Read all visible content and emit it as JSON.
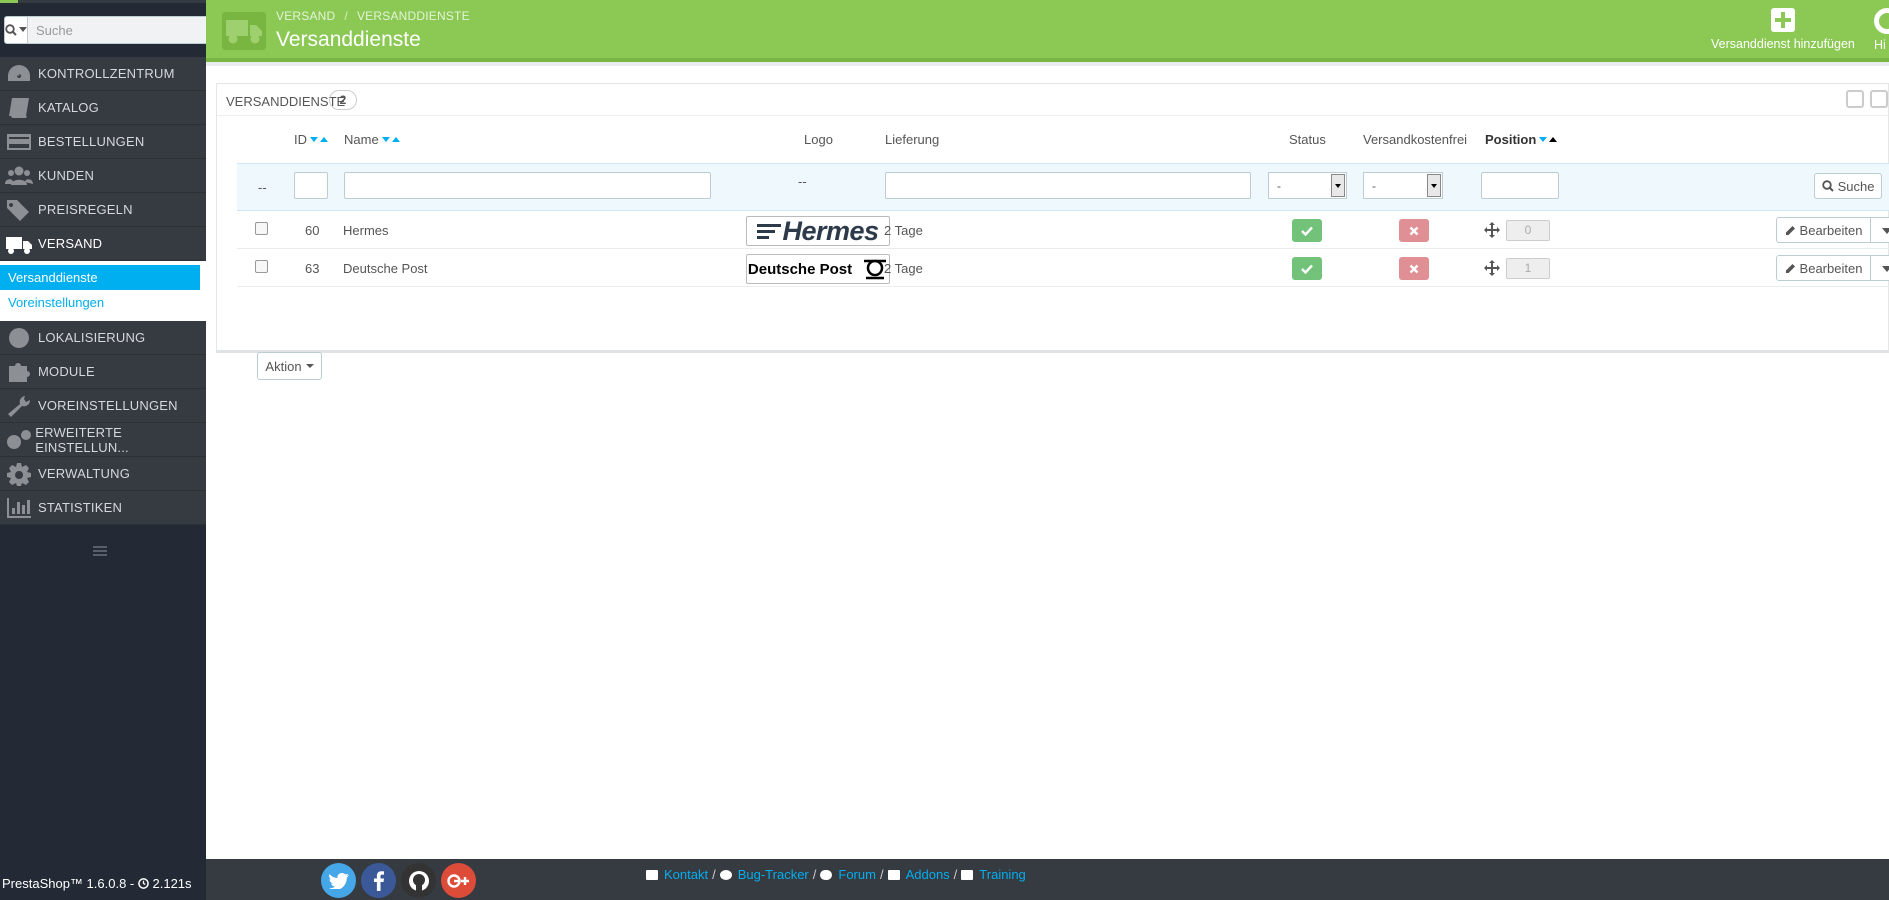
{
  "sidebar": {
    "search_placeholder": "Suche",
    "menu": [
      {
        "label": "KONTROLLZENTRUM",
        "icon": "dashboard-icon"
      },
      {
        "label": "KATALOG",
        "icon": "book-icon"
      },
      {
        "label": "BESTELLUNGEN",
        "icon": "credit-card-icon"
      },
      {
        "label": "KUNDEN",
        "icon": "users-icon"
      },
      {
        "label": "PREISREGELN",
        "icon": "tags-icon"
      },
      {
        "label": "VERSAND",
        "icon": "truck-icon"
      },
      {
        "label": "LOKALISIERUNG",
        "icon": "globe-icon"
      },
      {
        "label": "MODULE",
        "icon": "puzzle-icon"
      },
      {
        "label": "VOREINSTELLUNGEN",
        "icon": "wrench-icon"
      },
      {
        "label": "ERWEITERTE EINSTELLUN...",
        "icon": "cogs-icon"
      },
      {
        "label": "VERWALTUNG",
        "icon": "gear-icon"
      },
      {
        "label": "STATISTIKEN",
        "icon": "bar-chart-icon"
      }
    ],
    "submenu": [
      {
        "label": "Versanddienste"
      },
      {
        "label": "Voreinstellungen"
      }
    ],
    "version": "PrestaShop™ 1.6.0.8 -",
    "load_time": "2.121s"
  },
  "header": {
    "breadcrumb": [
      "VERSAND",
      "VERSANDDIENSTE"
    ],
    "title": "Versanddienste",
    "add_label": "Versanddienst hinzufügen",
    "help_label": "Hi"
  },
  "panel": {
    "title": "VERSANDDIENSTE",
    "count": "2",
    "columns": {
      "id": "ID",
      "name": "Name",
      "logo": "Logo",
      "delivery": "Lieferung",
      "status": "Status",
      "free": "Versandkostenfrei",
      "position": "Position"
    },
    "filter": {
      "dash": "--",
      "logo_dash": "--",
      "select_status": "-",
      "select_free": "-",
      "search_label": "Suche"
    },
    "rows": [
      {
        "id": "60",
        "name": "Hermes",
        "delivery": "2 Tage",
        "position": "0",
        "logo_text": "Hermes"
      },
      {
        "id": "63",
        "name": "Deutsche Post",
        "delivery": "2 Tage",
        "position": "1",
        "logo_text": "Deutsche Post"
      }
    ],
    "edit_label": "Bearbeiten",
    "action_label": "Aktion"
  },
  "footer": {
    "links": [
      {
        "label": "Kontakt",
        "icon": "envelope-icon"
      },
      {
        "label": "Bug-Tracker",
        "icon": "bug-icon"
      },
      {
        "label": "Forum",
        "icon": "comments-icon"
      },
      {
        "label": "Addons",
        "icon": "puzzle-icon"
      },
      {
        "label": "Training",
        "icon": "book-icon"
      }
    ],
    "social": [
      {
        "icon": "twitter-icon",
        "color": "#46a7e8"
      },
      {
        "icon": "facebook-icon",
        "color": "#3b5998"
      },
      {
        "icon": "github-icon",
        "color": "#333333"
      },
      {
        "icon": "google-plus-icon",
        "color": "#dd4b39"
      }
    ]
  },
  "colors": {
    "accent_green": "#8bc954",
    "link_blue": "#00aff0",
    "sidebar_bg": "#363a41",
    "status_ok": "#72c279",
    "status_no": "#e08f95"
  }
}
